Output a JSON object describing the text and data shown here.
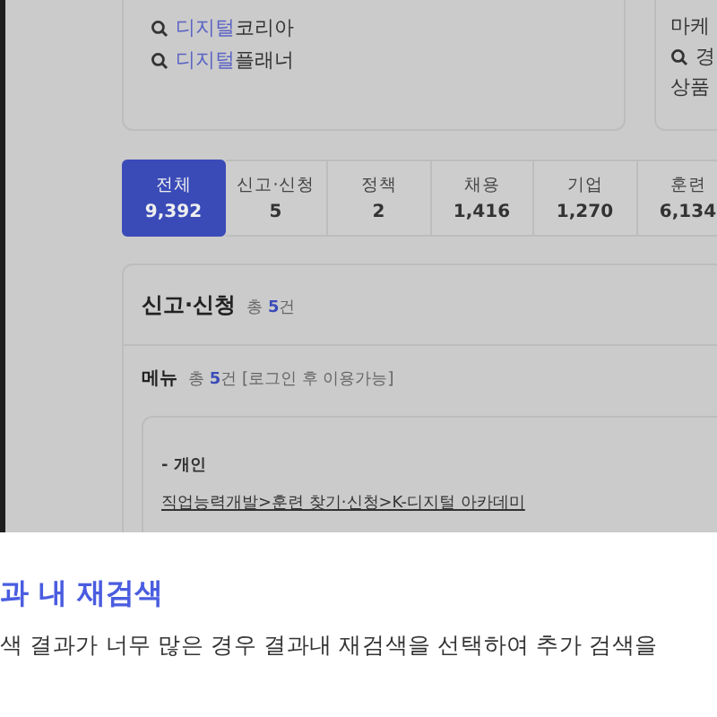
{
  "search_links": [
    {
      "highlight": "디지털",
      "rest": "코리아"
    },
    {
      "highlight": "디지털",
      "rest": "플래너"
    }
  ],
  "side_card": {
    "lines": [
      {
        "kind": "text",
        "text": "마케"
      },
      {
        "kind": "search",
        "text": "경"
      },
      {
        "kind": "text",
        "text": "상품"
      }
    ]
  },
  "tabs": [
    {
      "label": "전체",
      "count": "9,392",
      "selected": true
    },
    {
      "label": "신고·신청",
      "count": "5",
      "selected": false
    },
    {
      "label": "정책",
      "count": "2",
      "selected": false
    },
    {
      "label": "채용",
      "count": "1,416",
      "selected": false
    },
    {
      "label": "기업",
      "count": "1,270",
      "selected": false
    },
    {
      "label": "훈련",
      "count": "6,134",
      "selected": false
    }
  ],
  "section": {
    "title": "신고·신청",
    "total": {
      "prefix": "총",
      "count": "5",
      "suffix": "건"
    },
    "menu": {
      "title": "메뉴",
      "total": {
        "prefix": "총",
        "count": "5",
        "suffix": "건"
      },
      "note": "[로그인 후 이용가능]"
    },
    "result": {
      "group": "- 개인",
      "link": "직업능력개발>훈련 찾기·신청>K-디지털 아카데미"
    }
  },
  "help": {
    "heading": "과 내 재검색",
    "text": "색 결과가 너무 많은 경우 결과내 재검색을 선택하여 추가 검색을"
  }
}
